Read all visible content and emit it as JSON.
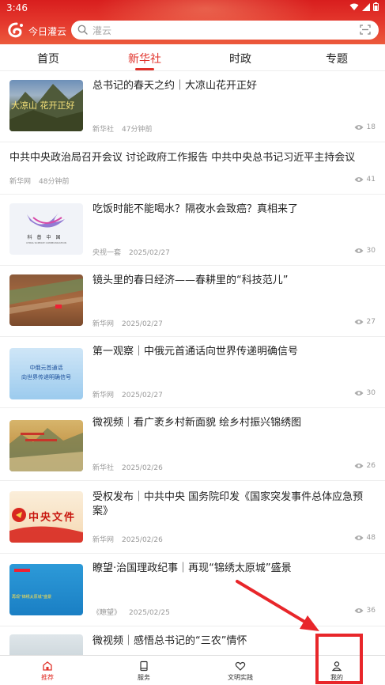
{
  "status": {
    "time": "3:46"
  },
  "app": {
    "name": "今日灌云"
  },
  "search": {
    "placeholder": "灌云"
  },
  "tabs": [
    {
      "label": "首页",
      "active": false
    },
    {
      "label": "新华社",
      "active": true
    },
    {
      "label": "时政",
      "active": false
    },
    {
      "label": "专题",
      "active": false
    }
  ],
  "feed": [
    {
      "title": "总书记的春天之约｜大凉山花开正好",
      "source": "新华社",
      "time": "47分钟前",
      "views": "18",
      "thumb_text": "大凉山 花开正好"
    },
    {
      "title": "中共中央政治局召开会议 讨论政府工作报告 中共中央总书记习近平主持会议",
      "source": "新华网",
      "time": "48分钟前",
      "views": "41"
    },
    {
      "title": "吃饭时能不能喝水？隔夜水会致癌？真相来了",
      "source": "央视一套",
      "time": "2025/02/27",
      "views": "30",
      "thumb_text": "科普中国",
      "thumb_sub": "CHINA SCIENCE COMMUNICATION"
    },
    {
      "title": "镜头里的春日经济——春耕里的“科技范儿”",
      "source": "新华网",
      "time": "2025/02/27",
      "views": "27"
    },
    {
      "title": "第一观察｜中俄元首通话向世界传递明确信号",
      "source": "新华网",
      "time": "2025/02/27",
      "views": "30",
      "thumb_text": "中俄元首通话",
      "thumb_text2": "向世界传递明确信号"
    },
    {
      "title": "微视频｜看广袤乡村新面貌 绘乡村振兴锦绣图",
      "source": "新华社",
      "time": "2025/02/26",
      "views": "26"
    },
    {
      "title": "受权发布｜中共中央 国务院印发《国家突发事件总体应急预案》",
      "source": "新华网",
      "time": "2025/02/26",
      "views": "48",
      "thumb_text": "中央文件"
    },
    {
      "title": "瞭望·治国理政纪事｜再现“锦绣太原城”盛景",
      "source": "《瞭望》",
      "time": "2025/02/25",
      "views": "36",
      "thumb_text": "再现“锦绣太原城”盛景"
    },
    {
      "title": "微视频｜感悟总书记的“三农”情怀"
    }
  ],
  "bottom_nav": [
    {
      "label": "推荐",
      "icon": "home-icon",
      "active": true
    },
    {
      "label": "服务",
      "icon": "book-icon",
      "active": false
    },
    {
      "label": "文明实践",
      "icon": "heart-icon",
      "active": false
    },
    {
      "label": "我的",
      "icon": "user-icon",
      "active": false
    }
  ],
  "colors": {
    "brand_red": "#e0322a",
    "annotation_red": "#e8262a"
  }
}
